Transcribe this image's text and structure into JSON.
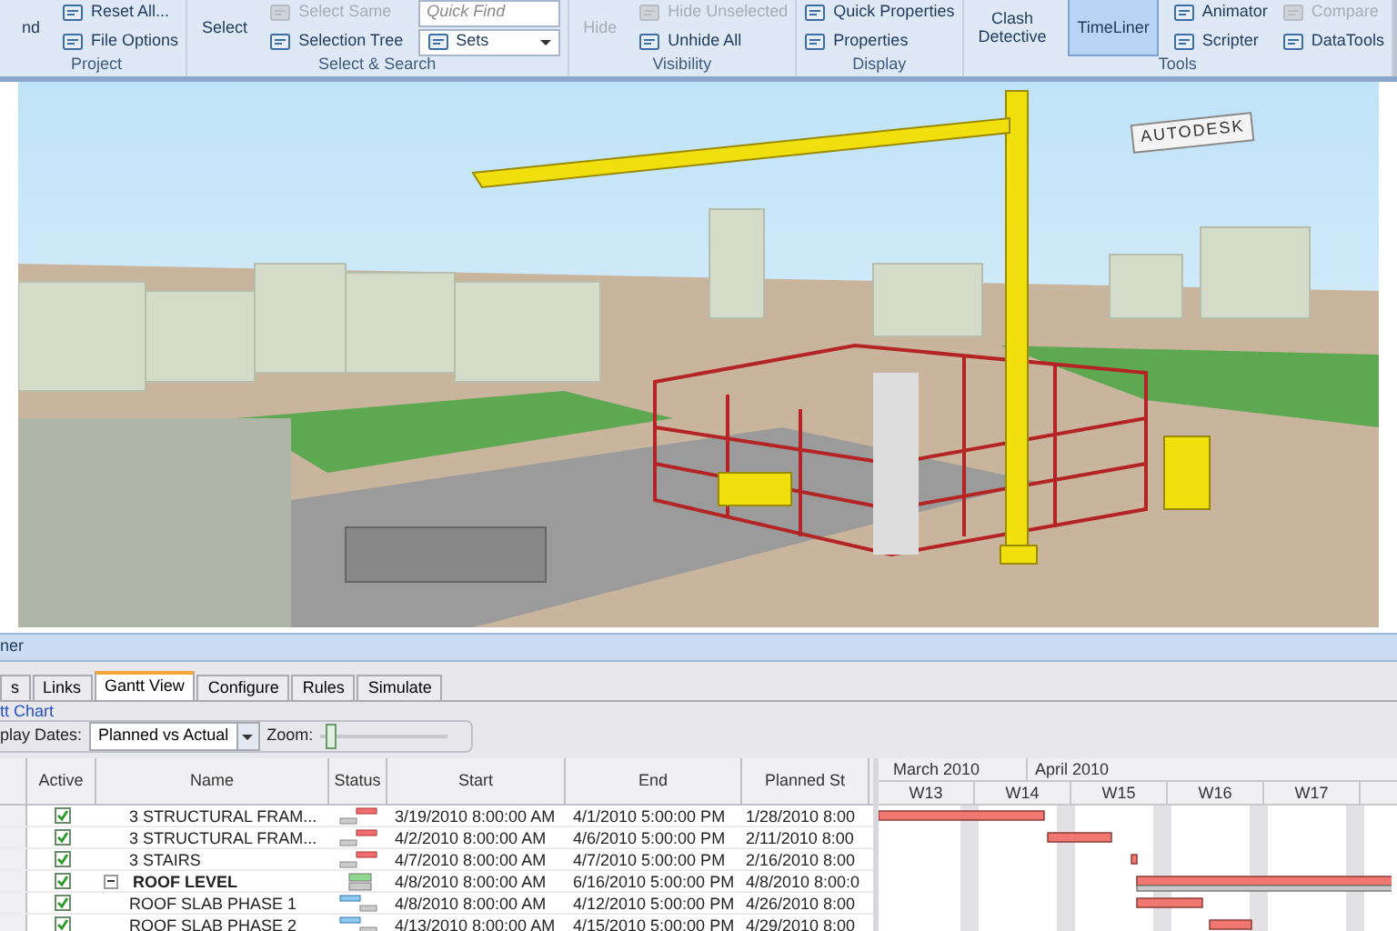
{
  "ribbon": {
    "groups": [
      {
        "label": "Project",
        "items": [
          {
            "label": "nd",
            "kind": "big",
            "disabled": false
          },
          {
            "label": "Reset All...",
            "kind": "small",
            "disabled": false
          },
          {
            "label": "File Options",
            "kind": "small",
            "disabled": false
          }
        ]
      },
      {
        "label": "Select & Search",
        "items": [
          {
            "label": "Select",
            "kind": "big",
            "disabled": false
          },
          {
            "label": "Select Same",
            "kind": "small",
            "disabled": true
          },
          {
            "label": "Selection Tree",
            "kind": "small",
            "disabled": false
          },
          {
            "placeholder": "Quick Find",
            "kind": "search"
          },
          {
            "label": "Sets",
            "kind": "dropdown"
          }
        ]
      },
      {
        "label": "Visibility",
        "items": [
          {
            "label": "Hide",
            "kind": "big",
            "disabled": true
          },
          {
            "label": "Hide Unselected",
            "kind": "small",
            "disabled": true
          },
          {
            "label": "Unhide All",
            "kind": "small",
            "disabled": false
          }
        ]
      },
      {
        "label": "Display",
        "items": [
          {
            "label": "Quick Properties",
            "kind": "small",
            "disabled": false
          },
          {
            "label": "Properties",
            "kind": "small",
            "disabled": false
          }
        ]
      },
      {
        "label": "Tools",
        "items": [
          {
            "label": "Clash Detective",
            "kind": "big",
            "disabled": false,
            "selected": false
          },
          {
            "label": "TimeLiner",
            "kind": "big",
            "disabled": false,
            "selected": true
          },
          {
            "label": "Animator",
            "kind": "small",
            "disabled": false
          },
          {
            "label": "Scripter",
            "kind": "small",
            "disabled": false
          },
          {
            "label": "Compare",
            "kind": "small",
            "disabled": true
          },
          {
            "label": "DataTools",
            "kind": "small",
            "disabled": false
          }
        ]
      }
    ]
  },
  "viewport": {
    "crane_sign": "AUTODESK"
  },
  "panel": {
    "title": "ner",
    "tabs": [
      {
        "label": "s",
        "selected": false
      },
      {
        "label": "Links",
        "selected": false
      },
      {
        "label": "Gantt View",
        "selected": true
      },
      {
        "label": "Configure",
        "selected": false
      },
      {
        "label": "Rules",
        "selected": false
      },
      {
        "label": "Simulate",
        "selected": false
      }
    ],
    "section_title": "tt Chart",
    "display_dates_label": "play Dates:",
    "display_dates_value": "Planned vs Actual",
    "zoom_label": "Zoom:",
    "zoom": {
      "level": 0.05
    },
    "table": {
      "columns": [
        "Active",
        "Name",
        "Status",
        "Start",
        "End",
        "Planned St"
      ],
      "rows": [
        {
          "active": true,
          "name": "3 STRUCTURAL FRAM...",
          "kind": "task",
          "status": {
            "kind": "late"
          },
          "start": "3/19/2010 8:00:00 AM",
          "end": "4/1/2010 5:00:00 PM",
          "planned_start": "1/28/2010 8:00"
        },
        {
          "active": true,
          "name": "3 STRUCTURAL FRAM...",
          "kind": "task",
          "status": {
            "kind": "late"
          },
          "start": "4/2/2010 8:00:00 AM",
          "end": "4/6/2010 5:00:00 PM",
          "planned_start": "2/11/2010 8:00"
        },
        {
          "active": true,
          "name": "3 STAIRS",
          "kind": "task",
          "status": {
            "kind": "late"
          },
          "start": "4/7/2010 8:00:00 AM",
          "end": "4/7/2010 5:00:00 PM",
          "planned_start": "2/16/2010 8:00"
        },
        {
          "active": true,
          "name": "ROOF LEVEL",
          "kind": "group",
          "expanded": true,
          "status": {
            "kind": "ontime"
          },
          "start": "4/8/2010 8:00:00 AM",
          "end": "6/16/2010 5:00:00 PM",
          "planned_start": "4/8/2010 8:00:0"
        },
        {
          "active": true,
          "name": "ROOF SLAB PHASE 1",
          "kind": "task",
          "status": {
            "kind": "early"
          },
          "start": "4/8/2010 8:00:00 AM",
          "end": "4/12/2010 5:00:00 PM",
          "planned_start": "4/26/2010 8:00"
        },
        {
          "active": true,
          "name": "ROOF SLAB PHASE 2",
          "kind": "task",
          "status": {
            "kind": "early"
          },
          "start": "4/13/2010 8:00:00 AM",
          "end": "4/15/2010 5:00:00 PM",
          "planned_start": "4/29/2010 8:00"
        }
      ]
    },
    "gantt": {
      "months": [
        "March 2010",
        "April 2010"
      ],
      "weeks": [
        "W13",
        "W14",
        "W15",
        "W16",
        "W17"
      ]
    }
  }
}
